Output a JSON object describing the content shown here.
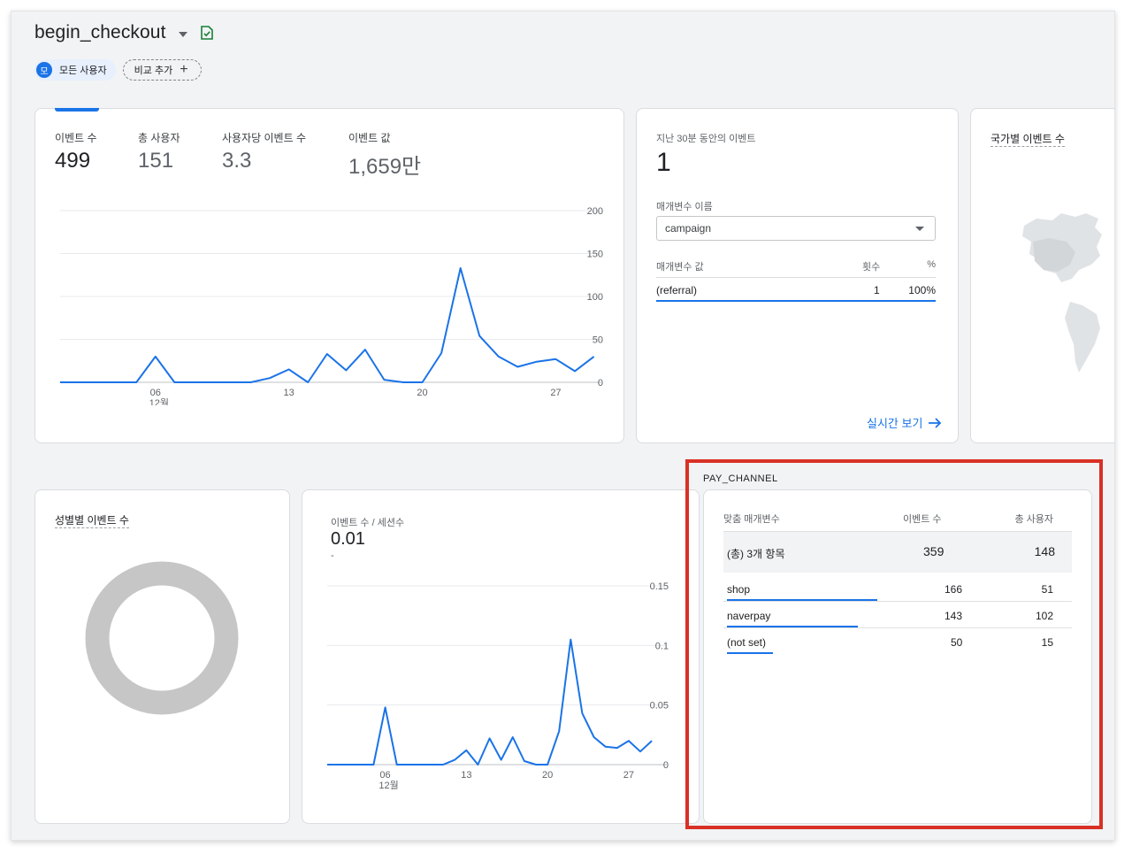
{
  "header": {
    "title": "begin_checkout",
    "segment_chip": {
      "avatar": "모",
      "label": "모든 사용자"
    },
    "compare_chip": {
      "label": "비교 추가",
      "icon": "+"
    }
  },
  "overview_card": {
    "kpis": [
      {
        "label": "이벤트 수",
        "value": "499"
      },
      {
        "label": "총 사용자",
        "value": "151"
      },
      {
        "label": "사용자당 이벤트 수",
        "value": "3.3"
      },
      {
        "label": "이벤트 값",
        "value": "1,659만"
      }
    ],
    "chart_data": {
      "type": "line",
      "x_ticks": [
        "06",
        "13",
        "20",
        "27"
      ],
      "x_sub": "12월",
      "y_ticks": [
        "200",
        "150",
        "100",
        "50",
        "0"
      ],
      "ylim": [
        0,
        200
      ],
      "x": [
        1,
        2,
        3,
        4,
        5,
        6,
        7,
        8,
        9,
        10,
        11,
        12,
        13,
        14,
        15,
        16,
        17,
        18,
        19,
        20,
        21,
        22,
        23,
        24,
        25,
        26,
        27,
        28,
        29,
        30,
        31
      ],
      "values": [
        0,
        0,
        0,
        0,
        0,
        30,
        0,
        0,
        0,
        0,
        0,
        5,
        15,
        0,
        33,
        14,
        38,
        3,
        0,
        0,
        34,
        133,
        54,
        30,
        18,
        24,
        27,
        13,
        30,
        null,
        null
      ],
      "color": "#1a73e8"
    }
  },
  "realtime_card": {
    "title": "지난 30분 동안의 이벤트",
    "value": "1",
    "param_label": "매개변수 이름",
    "param_select": "campaign",
    "table_headers": [
      "매개변수 값",
      "횟수",
      "%"
    ],
    "rows": [
      {
        "value": "(referral)",
        "count": "1",
        "pct": "100%"
      }
    ],
    "link": "실시간 보기"
  },
  "country_card": {
    "title": "국가별 이벤트 수"
  },
  "gender_card": {
    "title": "성별별 이벤트 수"
  },
  "ratio_card": {
    "title": "이벤트 수 / 세션수",
    "value": "0.01",
    "sub": "-",
    "chart_data": {
      "type": "line",
      "x_ticks": [
        "06",
        "13",
        "20",
        "27"
      ],
      "x_sub": "12월",
      "y_ticks": [
        "0.15",
        "0.1",
        "0.05",
        "0"
      ],
      "ylim": [
        0,
        0.15
      ],
      "x": [
        1,
        2,
        3,
        4,
        5,
        6,
        7,
        8,
        9,
        10,
        11,
        12,
        13,
        14,
        15,
        16,
        17,
        18,
        19,
        20,
        21,
        22,
        23,
        24,
        25,
        26,
        27,
        28,
        29,
        30,
        31
      ],
      "values": [
        0,
        0,
        0,
        0,
        0,
        0.048,
        0,
        0,
        0,
        0,
        0,
        0.004,
        0.012,
        0,
        0.022,
        0.004,
        0.023,
        0.003,
        0,
        0,
        0.028,
        0.105,
        0.043,
        0.023,
        0.015,
        0.014,
        0.02,
        0.011,
        0.02,
        null,
        null
      ],
      "color": "#1a73e8"
    }
  },
  "pay_channel": {
    "section_label": "PAY_CHANNEL",
    "headers": [
      "맞춤 매개변수",
      "이벤트 수",
      "총 사용자"
    ],
    "total": {
      "label": "(총) 3개 항목",
      "events": "359",
      "users": "148"
    },
    "rows": [
      {
        "label": "shop",
        "events": "166",
        "users": "51",
        "share": 0.46
      },
      {
        "label": "naverpay",
        "events": "143",
        "users": "102",
        "share": 0.4
      },
      {
        "label": "(not set)",
        "events": "50",
        "users": "15",
        "share": 0.14
      }
    ],
    "highlight_color": "#d93025"
  }
}
